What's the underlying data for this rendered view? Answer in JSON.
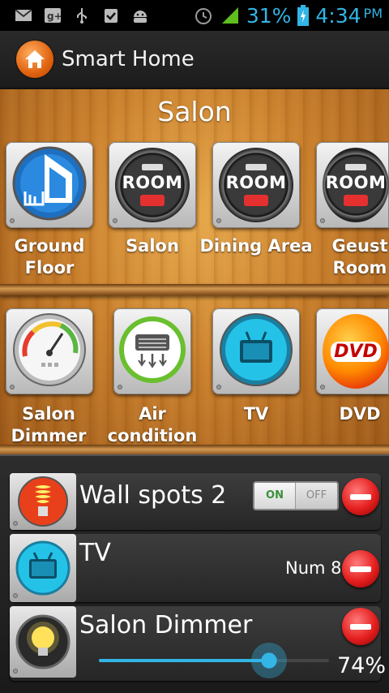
{
  "status_bar": {
    "battery_text": "31%",
    "time": "4:34",
    "ampm": "PM",
    "accent_color": "#33b5e5",
    "icons": [
      "gmail-icon",
      "google-plus-icon",
      "usb-icon",
      "clipboard-check-icon",
      "android-icon",
      "alarm-icon",
      "signal-icon",
      "battery-charging-icon"
    ]
  },
  "action_bar": {
    "title": "Smart Home",
    "icon": "home-icon"
  },
  "room": {
    "title": "Salon",
    "zones": [
      {
        "label_line1": "Ground",
        "label_line2": "Floor",
        "icon": "house-plan-icon"
      },
      {
        "label_line1": "Salon",
        "label_line2": "",
        "icon": "room-icon",
        "badge": "ROOM"
      },
      {
        "label_line1": "Dining Area",
        "label_line2": "",
        "icon": "room-icon",
        "badge": "ROOM"
      },
      {
        "label_line1": "Geust",
        "label_line2": "Room",
        "icon": "room-icon",
        "badge": "ROOM"
      }
    ],
    "devices": [
      {
        "label_line1": "Salon",
        "label_line2": "Dimmer",
        "icon": "gauge-icon"
      },
      {
        "label_line1": "Air",
        "label_line2": "condition",
        "icon": "air-conditioner-icon"
      },
      {
        "label_line1": "TV",
        "label_line2": "",
        "icon": "tv-icon"
      },
      {
        "label_line1": "DVD",
        "label_line2": "",
        "icon": "dvd-icon",
        "badge": "DVD"
      }
    ]
  },
  "controls": [
    {
      "title": "Wall spots 2",
      "icon": "light-bulb-spiral-icon",
      "toggle_on": "ON",
      "toggle_off": "OFF",
      "state": "on"
    },
    {
      "title": "TV",
      "icon": "tv-icon",
      "value": "Num 8"
    },
    {
      "title": "Salon Dimmer",
      "icon": "light-bulb-icon",
      "percent": "74%",
      "level": 0.74
    }
  ]
}
